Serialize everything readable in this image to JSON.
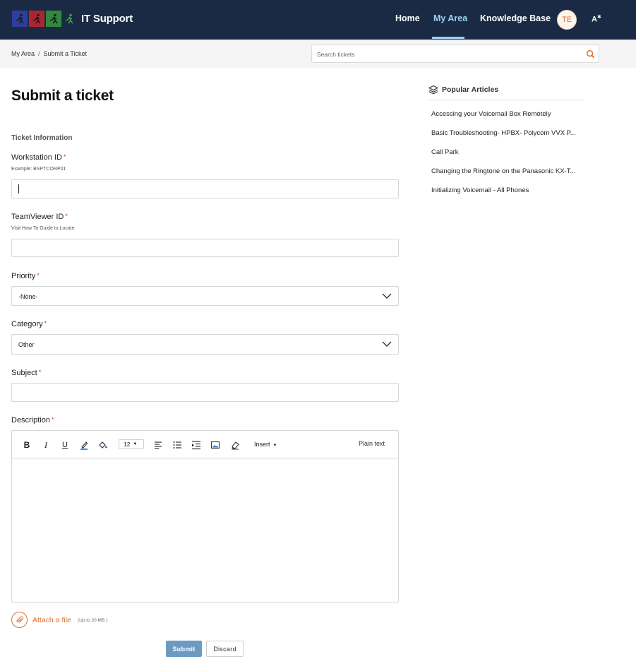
{
  "header": {
    "brand": "IT Support",
    "nav": {
      "home": "Home",
      "my_area": "My Area",
      "knowledge_base": "Knowledge Base"
    },
    "avatar_initials": "TE",
    "accessibility_label": "A",
    "accent": "#9cd1f2",
    "background": "#1b2a44"
  },
  "breadcrumb": {
    "items": [
      "My Area",
      "Submit a Ticket"
    ],
    "separator": "/"
  },
  "search": {
    "placeholder": "Search tickets",
    "icon": "search-icon"
  },
  "form": {
    "title": "Submit a ticket",
    "section": "Ticket Information",
    "required_mark": "*",
    "workstation": {
      "label": "Workstation ID",
      "hint": "Example: BSPTCORP01",
      "value": ""
    },
    "teamviewer": {
      "label": "TeamViewer ID",
      "hint": "Visit How To Guide to Locate",
      "value": ""
    },
    "priority": {
      "label": "Priority",
      "selected": "-None-"
    },
    "category": {
      "label": "Category",
      "selected": "Other"
    },
    "subject": {
      "label": "Subject",
      "value": ""
    },
    "description": {
      "label": "Description",
      "toolbar": {
        "bold": "B",
        "italic": "I",
        "underline": "U",
        "font_size": "12",
        "insert": "Insert",
        "plain_text": "Plain text"
      }
    },
    "attach": {
      "label": "Attach a file",
      "note": "(Up to 20 MB )"
    },
    "submit_label": "Submit",
    "discard_label": "Discard",
    "accent": "#e06d2d",
    "submit_color": "#6b9bc2"
  },
  "sidebar": {
    "title": "Popular Articles",
    "articles": [
      "Accessing your Voicemail Box Remotely",
      "Basic Troubleshooting- HPBX- Polycom VVX P...",
      "Call Park",
      "Changing the Ringtone on the Panasonic KX-T...",
      "Initializing Voicemail - All Phones"
    ]
  }
}
